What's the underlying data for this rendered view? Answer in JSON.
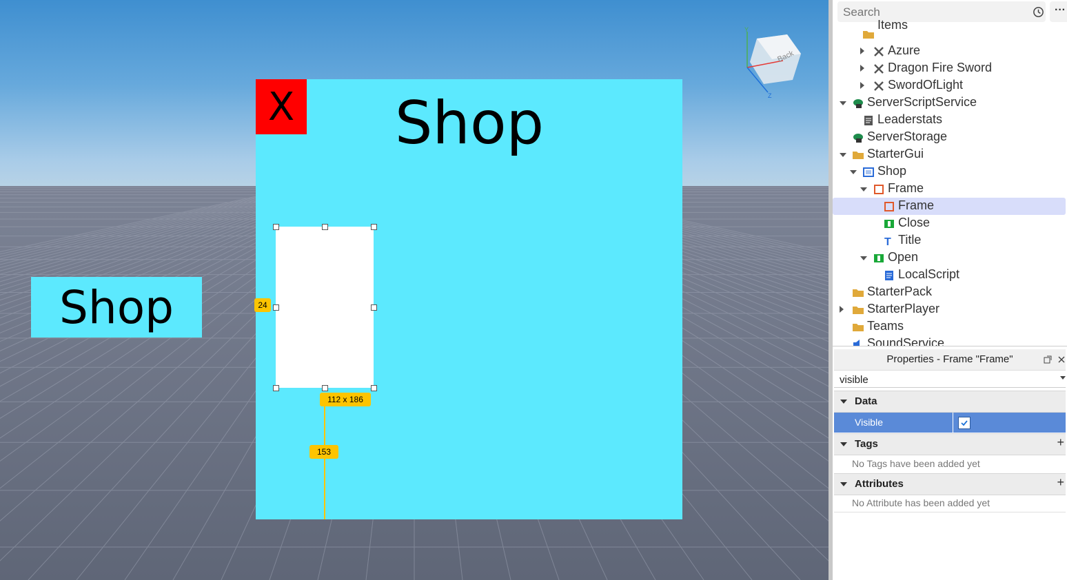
{
  "viewport": {
    "viewcube_label": "Back",
    "open_button_label": "Shop",
    "shop_frame": {
      "close_label": "X",
      "title": "Shop"
    },
    "selection": {
      "left_offset_badge": "24",
      "size_badge": "112 x 186",
      "bottom_offset_badge": "153"
    }
  },
  "explorer": {
    "search_placeholder": "Search",
    "more_label": "···",
    "rows": [
      {
        "label": "Items",
        "icon": "folder-icon"
      },
      {
        "label": "Azure",
        "icon": "tool-icon"
      },
      {
        "label": "Dragon Fire Sword",
        "icon": "tool-icon"
      },
      {
        "label": "SwordOfLight",
        "icon": "tool-icon"
      },
      {
        "label": "ServerScriptService",
        "icon": "server-script-service-icon"
      },
      {
        "label": "Leaderstats",
        "icon": "script-icon"
      },
      {
        "label": "ServerStorage",
        "icon": "server-storage-icon"
      },
      {
        "label": "StarterGui",
        "icon": "starter-gui-icon"
      },
      {
        "label": "Shop",
        "icon": "screen-gui-icon"
      },
      {
        "label": "Frame",
        "icon": "frame-icon"
      },
      {
        "label": "Frame",
        "icon": "frame-icon"
      },
      {
        "label": "Close",
        "icon": "text-button-icon"
      },
      {
        "label": "Title",
        "icon": "text-label-icon"
      },
      {
        "label": "Open",
        "icon": "text-button-icon"
      },
      {
        "label": "LocalScript",
        "icon": "local-script-icon"
      },
      {
        "label": "StarterPack",
        "icon": "starter-pack-icon"
      },
      {
        "label": "StarterPlayer",
        "icon": "starter-player-icon"
      },
      {
        "label": "Teams",
        "icon": "teams-icon"
      },
      {
        "label": "SoundService",
        "icon": "sound-service-icon"
      }
    ]
  },
  "properties": {
    "header": "Properties - Frame \"Frame\"",
    "filter_value": "visible",
    "sections": {
      "data": "Data",
      "tags": "Tags",
      "attributes": "Attributes"
    },
    "visible_label": "Visible",
    "visible_checked": true,
    "tags_empty": "No Tags have been added yet",
    "attributes_empty": "No Attribute has been added yet"
  },
  "colors": {
    "frame_cyan": "#5ce9fe",
    "close_red": "#ff0000",
    "selection_yellow": "#fdc400",
    "selected_row": "#d8ddfa",
    "selected_prop": "#5a8ad8"
  }
}
